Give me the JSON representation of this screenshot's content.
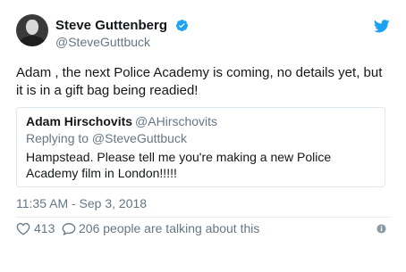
{
  "tweet": {
    "author": {
      "display_name": "Steve Guttenberg",
      "handle": "@SteveGuttbuck",
      "verified": true
    },
    "text": "Adam , the next Police Academy is coming, no details yet, but it is in a gift bag being readied!",
    "timestamp": "11:35 AM - Sep 3, 2018",
    "likes": "413",
    "talking": "206 people are talking about this"
  },
  "quoted_tweet": {
    "display_name": "Adam Hirschovits",
    "handle": "@AHirschovits",
    "reply_context": "Replying to @SteveGuttbuck",
    "text": "Hampstead. Please tell me you're making a new Police Academy film in London!!!!!"
  },
  "icons": {
    "verified": "verified-badge-icon",
    "brand": "twitter-bird-icon",
    "like": "heart-icon",
    "reply": "speech-bubble-icon",
    "info": "info-icon"
  },
  "colors": {
    "twitter_blue": "#1da1f2",
    "text_primary": "#14171a",
    "text_secondary": "#657786",
    "border": "#e1e8ed"
  }
}
